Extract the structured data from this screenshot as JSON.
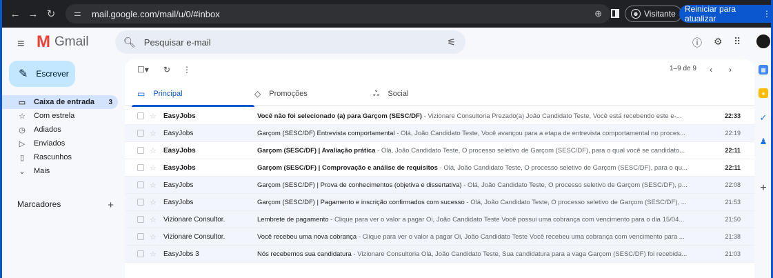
{
  "browser": {
    "url": "mail.google.com/mail/u/0/#inbox",
    "guest_label": "Visitante",
    "restart_label": "Reiniciar para atualizar"
  },
  "app": {
    "name": "Gmail",
    "search_placeholder": "Pesquisar e-mail"
  },
  "compose_label": "Escrever",
  "nav": [
    {
      "label": "Caixa de entrada",
      "icon": "inbox-icon",
      "count": "3",
      "active": true
    },
    {
      "label": "Com estrela",
      "icon": "star-icon",
      "count": ""
    },
    {
      "label": "Adiados",
      "icon": "clock-icon",
      "count": ""
    },
    {
      "label": "Enviados",
      "icon": "send-icon",
      "count": ""
    },
    {
      "label": "Rascunhos",
      "icon": "draft-icon",
      "count": ""
    },
    {
      "label": "Mais",
      "icon": "chevron-down-icon",
      "count": ""
    }
  ],
  "labels_heading": "Marcadores",
  "pagination": "1–9 de 9",
  "tabs": [
    {
      "label": "Principal",
      "icon": "inbox-icon"
    },
    {
      "label": "Promoções",
      "icon": "tag-icon"
    },
    {
      "label": "Social",
      "icon": "people-icon"
    }
  ],
  "emails": [
    {
      "sender": "EasyJobs",
      "subject": "Você não foi selecionado (a) para Garçom (SESC/DF)",
      "snippet": " - Vizionare Consultoria Prezado(a) João Candidato Teste, Você está recebendo este e-...",
      "date": "22:33",
      "unread": true
    },
    {
      "sender": "EasyJobs",
      "subject": "Garçom (SESC/DF) Entrevista comportamental",
      "snippet": " - Olá, João Candidato Teste, Você avançou para a etapa de entrevista comportamental no proces...",
      "date": "22:19",
      "unread": false
    },
    {
      "sender": "EasyJobs",
      "subject": "Garçom (SESC/DF) | Avaliação prática",
      "snippet": " - Olá, João Candidato Teste, O processo seletivo de Garçom (SESC/DF), para o qual você se candidato...",
      "date": "22:11",
      "unread": true
    },
    {
      "sender": "EasyJobs",
      "subject": "Garçom (SESC/DF) | Comprovação e análise de requisitos",
      "snippet": " - Olá, João Candidato Teste, O processo seletivo de Garçom (SESC/DF), para o qu...",
      "date": "22:11",
      "unread": true
    },
    {
      "sender": "EasyJobs",
      "subject": "Garçom (SESC/DF) | Prova de conhecimentos (objetiva e dissertativa)",
      "snippet": " - Olá, João Candidato Teste, O processo seletivo de Garçom (SESC/DF), p...",
      "date": "22:08",
      "unread": false
    },
    {
      "sender": "EasyJobs",
      "subject": "Garçom (SESC/DF) | Pagamento e inscrição confirmados com sucesso",
      "snippet": " - Olá, João Candidato Teste, O processo seletivo de Garçom (SESC/DF), ...",
      "date": "21:53",
      "unread": false
    },
    {
      "sender": "Vizionare Consultor.",
      "subject": "Lembrete de pagamento",
      "snippet": " - Clique para ver o valor a pagar Oi, João Candidato Teste Você possui uma cobrança com vencimento para o dia 15/04...",
      "date": "21:50",
      "unread": false
    },
    {
      "sender": "Vizionare Consultor.",
      "subject": "Você recebeu uma nova cobrança",
      "snippet": " - Clique para ver o valor a pagar Oi, João Candidato Teste Você recebeu uma cobrança com vencimento para ...",
      "date": "21:38",
      "unread": false
    },
    {
      "sender": "EasyJobs 3",
      "subject": "Nós recebemos sua candidatura",
      "snippet": " - Vizionare Consultoria Olá, João Candidato Teste, Sua candidatura para a vaga Garçom (SESC/DF) foi recebida...",
      "date": "21:03",
      "unread": false
    }
  ]
}
